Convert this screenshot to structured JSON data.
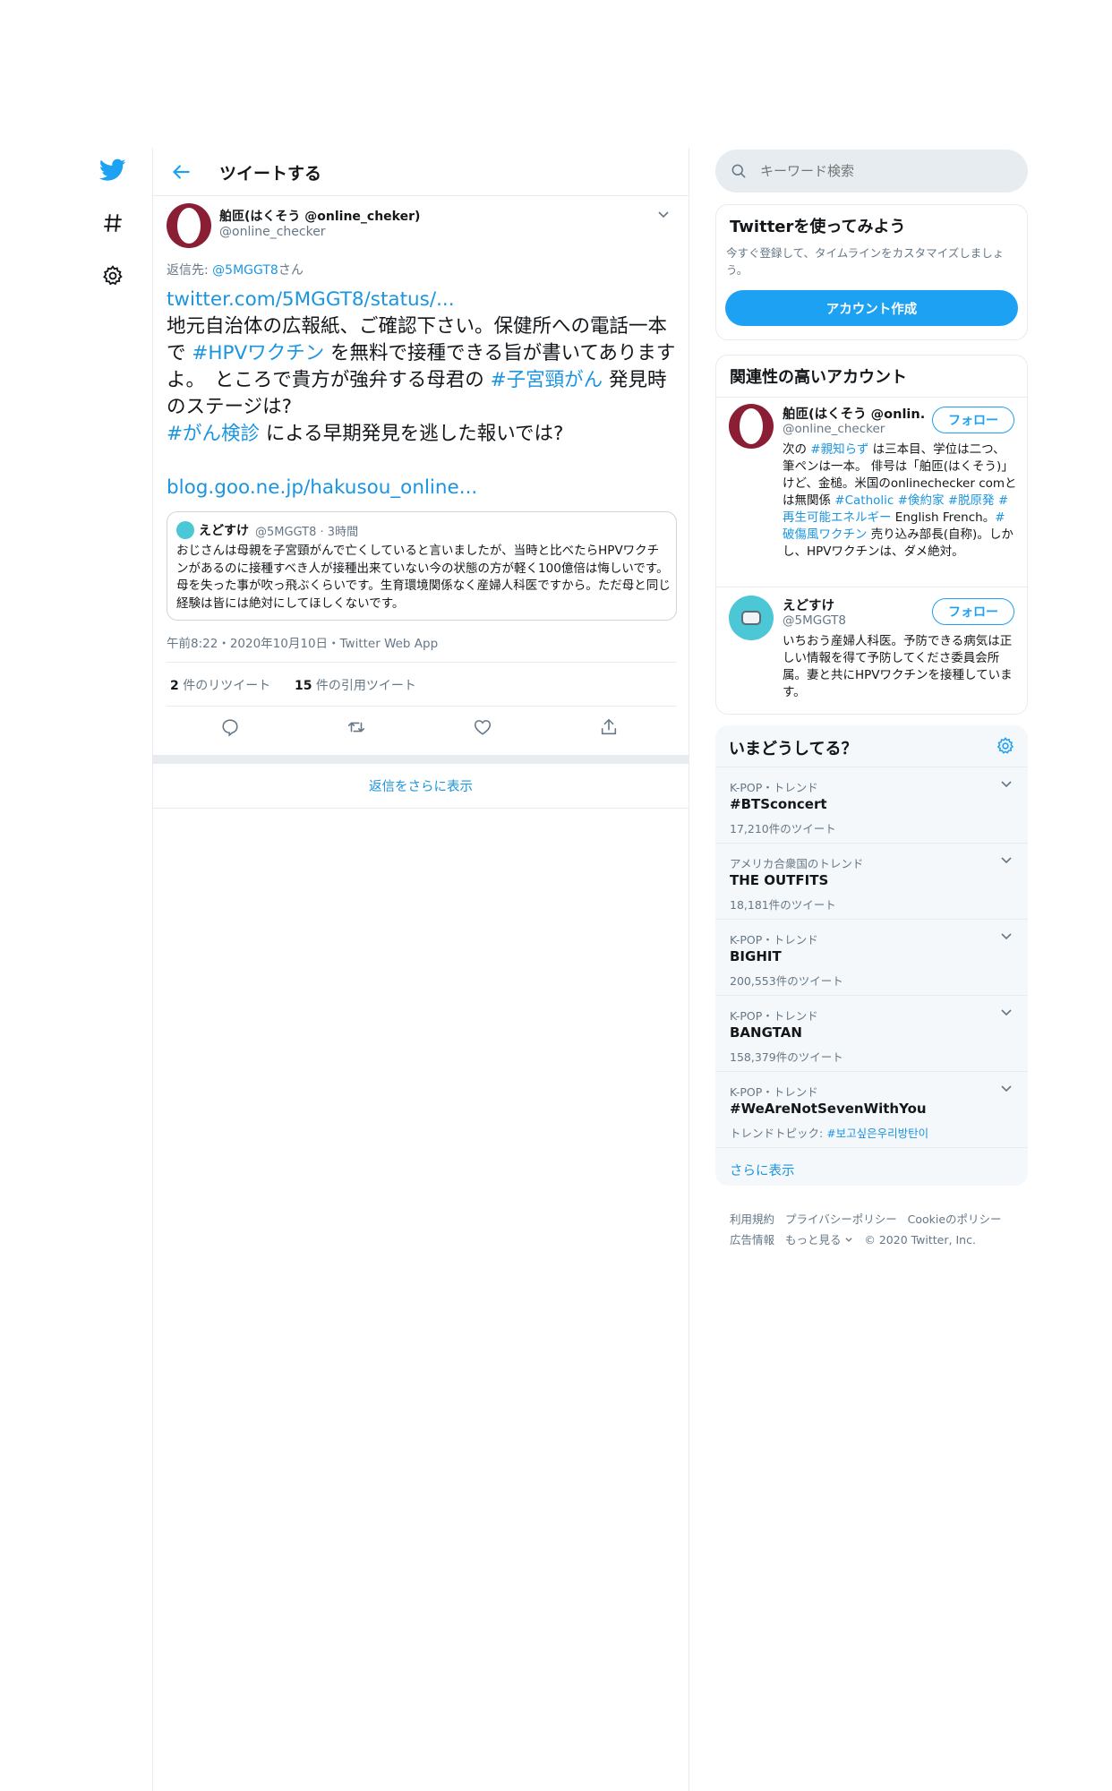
{
  "nav": {
    "twitter_icon": "twitter-bird-icon",
    "explore_icon": "hashtag-icon",
    "settings_icon": "gear-icon"
  },
  "header": {
    "title": "ツイートする"
  },
  "tweet": {
    "author_name": "舶匝(はくそう @online_cheker)",
    "author_handle": "@online_checker",
    "reply_to_prefix": "返信先: ",
    "reply_to_handle": "@5MGGT8",
    "reply_to_suffix": "さん",
    "body": {
      "link1": "twitter.com/5MGGT8/status/...",
      "text1": "地元自治体の広報紙、ご確認下さい。保健所への電話一本で ",
      "hashtag1": "#HPVワクチン",
      "text2": " を無料で接種できる旨が書いてありますよ。　ところで貴方が強弁する母君の ",
      "hashtag2": "#子宮頸がん",
      "text3": " 発見時のステージは?",
      "hashtag3": "#がん検診",
      "text4": " による早期発見を逃した報いでは?",
      "link2": "blog.goo.ne.jp/hakusou_online..."
    },
    "quote": {
      "author_name": "えどすけ",
      "author_handle": "@5MGGT8",
      "time": "3時間",
      "text": "おじさんは母親を子宮頸がんで亡くしていると言いましたが、当時と比べたらHPVワクチンがあるのに接種すべき人が接種出来ていない今の状態の方が軽く100億倍は悔しいです。母を失った事が吹っ飛ぶくらいです。生育環境関係なく産婦人科医ですから。ただ母と同じ経験は皆には絶対にしてほしくないです。"
    },
    "timestamp": "午前8:22・2020年10月10日・Twitter Web App",
    "retweet_count": "2",
    "retweet_label": " 件のリツイート",
    "quote_count": "15",
    "quote_label": " 件の引用ツイート",
    "actions": [
      "reply-icon",
      "retweet-icon",
      "like-icon",
      "share-icon"
    ]
  },
  "show_more_replies": "返信をさらに表示",
  "search": {
    "placeholder": "キーワード検索"
  },
  "signup_card": {
    "title": "Twitterを使ってみよう",
    "desc": "今すぐ登録して、タイムラインをカスタマイズしましょう。",
    "button": "アカウント作成"
  },
  "related": {
    "title": "関連性の高いアカウント",
    "accounts": [
      {
        "name": "舶匝(はくそう @onlin...",
        "handle": "@online_checker",
        "follow": "フォロー",
        "bio": [
          {
            "t": "次の "
          },
          {
            "t": "#親知らず",
            "h": true
          },
          {
            "t": " は三本目、学位は二つ、筆ペンは一本。 俳号は「舶匝(はくそう)」けど、金槌。米国のonlinechecker comとは無関係 "
          },
          {
            "t": "#Catholic",
            "h": true
          },
          {
            "t": " "
          },
          {
            "t": "#倹約家",
            "h": true
          },
          {
            "t": " "
          },
          {
            "t": "#脱原発",
            "h": true
          },
          {
            "t": " "
          },
          {
            "t": "#再生可能エネルギー",
            "h": true
          },
          {
            "t": " English French。"
          },
          {
            "t": "#破傷風ワクチン",
            "h": true
          },
          {
            "t": " 売り込み部長(自称)。しかし、HPVワクチンは、ダメ絶対。"
          }
        ]
      },
      {
        "name": "えどすけ",
        "handle": "@5MGGT8",
        "follow": "フォロー",
        "bio": "いちおう産婦人科医。予防できる病気は正しい情報を得て予防してくださ委員会所属。妻と共にHPVワクチンを接種しています。"
      }
    ]
  },
  "trends": {
    "title": "いまどうしてる？",
    "items": [
      {
        "meta": "K-POP・トレンド",
        "name": "#BTSconcert",
        "count": "17,210件のツイート"
      },
      {
        "meta": "アメリカ合衆国のトレンド",
        "name": "THE OUTFITS",
        "count": "18,181件のツイート"
      },
      {
        "meta": "K-POP・トレンド",
        "name": "BIGHIT",
        "count": "200,553件のツイート"
      },
      {
        "meta": "K-POP・トレンド",
        "name": "BANGTAN",
        "count": "158,379件のツイート"
      },
      {
        "meta": "K-POP・トレンド",
        "name": "#WeAreNotSevenWithYou",
        "count_prefix": "トレンドトピック: ",
        "count_link": "#보고싶은우리방탄이"
      }
    ],
    "show_more": "さらに表示"
  },
  "footer": {
    "row1": [
      "利用規約",
      "プライバシーポリシー",
      "Cookieのポリシー"
    ],
    "row2": [
      "広告情報",
      "もっと見る",
      "© 2020 Twitter, Inc."
    ]
  },
  "colors": {
    "accent": "#1da1f2",
    "link": "#1b95e0",
    "border": "#e6ecf0",
    "panel_bg": "#f5f8fa"
  }
}
